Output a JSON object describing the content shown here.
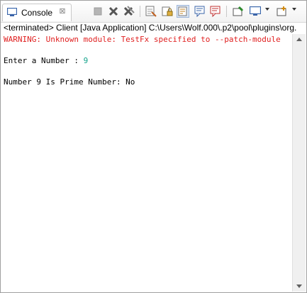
{
  "tab": {
    "label": "Console",
    "close_glyph": "⊠"
  },
  "toolbar": {
    "buttons": [
      "terminate-icon",
      "remove-launch-icon",
      "remove-all-terminated-icon",
      "clear-console-icon",
      "scroll-lock-icon",
      "word-wrap-icon",
      "show-console-on-stdout-icon",
      "show-console-on-stderr-icon",
      "pin-console-icon",
      "display-selected-console-icon",
      "open-console-icon"
    ]
  },
  "status_line": "<terminated> Client [Java Application] C:\\Users\\Wolf.000\\.p2\\pool\\plugins\\org.",
  "console": {
    "warning": "WARNING: Unknown module: TestFx specified to --patch-module",
    "prompt": "Enter a Number : ",
    "input_value": "9",
    "result": "Number 9 Is Prime Number: No"
  },
  "colors": {
    "warning": "#e02020",
    "input": "#14a38b"
  }
}
